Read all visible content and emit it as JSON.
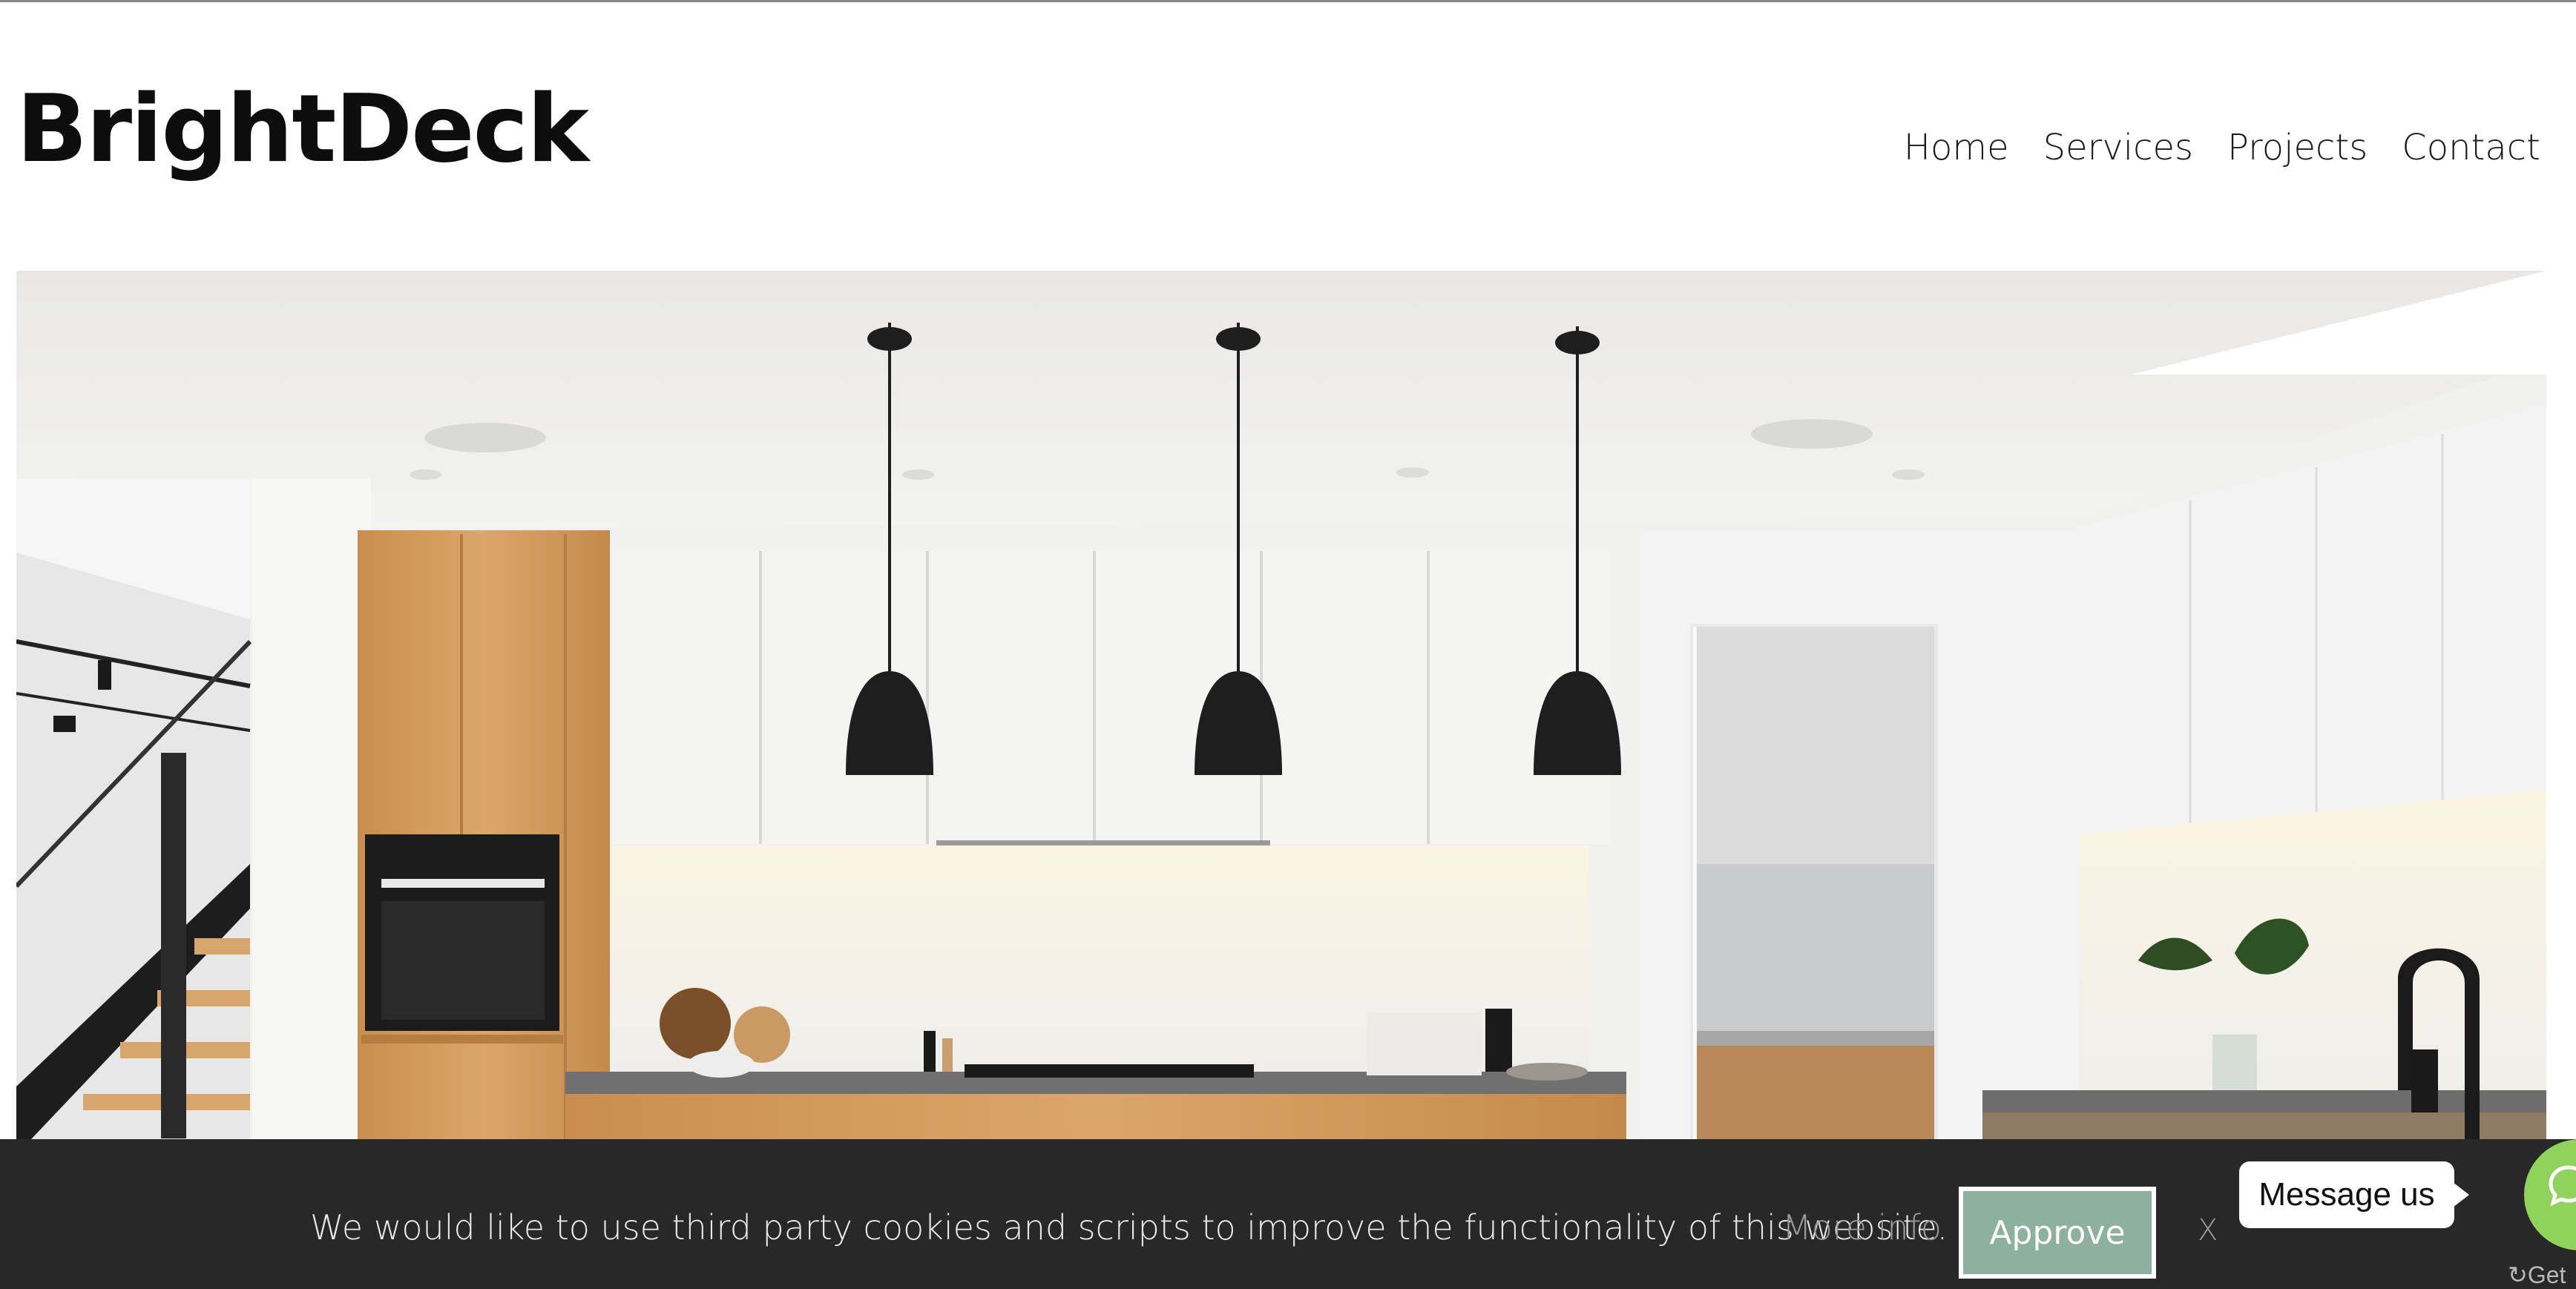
{
  "site": {
    "logo": "BrightDeck"
  },
  "nav": {
    "items": [
      "Home",
      "Services",
      "Projects",
      "Contact"
    ]
  },
  "hero": {
    "alt_kind": "kitchen-photo"
  },
  "cookie": {
    "message": "We would like to use third party cookies and scripts to improve the functionality of this website.",
    "more_info": "More info",
    "approve": "Approve",
    "close": "X"
  },
  "chat": {
    "bubble": "Message us",
    "brand": "Get"
  },
  "colors": {
    "cookie_bg": "#282828",
    "approve_bg": "#8eb09f",
    "chat_green": "#8fd35c",
    "wood": "#cf9a5c"
  },
  "icons": {
    "chat": "chat-bubble-icon"
  }
}
